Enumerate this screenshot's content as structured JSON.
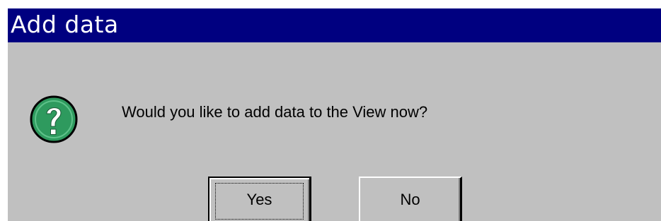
{
  "window": {
    "title": "Add data"
  },
  "dialog": {
    "icon": "question-icon",
    "message": "Would you like to add data to the View now?"
  },
  "buttons": {
    "yes_label": "Yes",
    "no_label": "No"
  },
  "colors": {
    "titlebar": "#000080",
    "dialog_face": "#c0c0c0",
    "icon_fill": "#2e9a5e"
  }
}
